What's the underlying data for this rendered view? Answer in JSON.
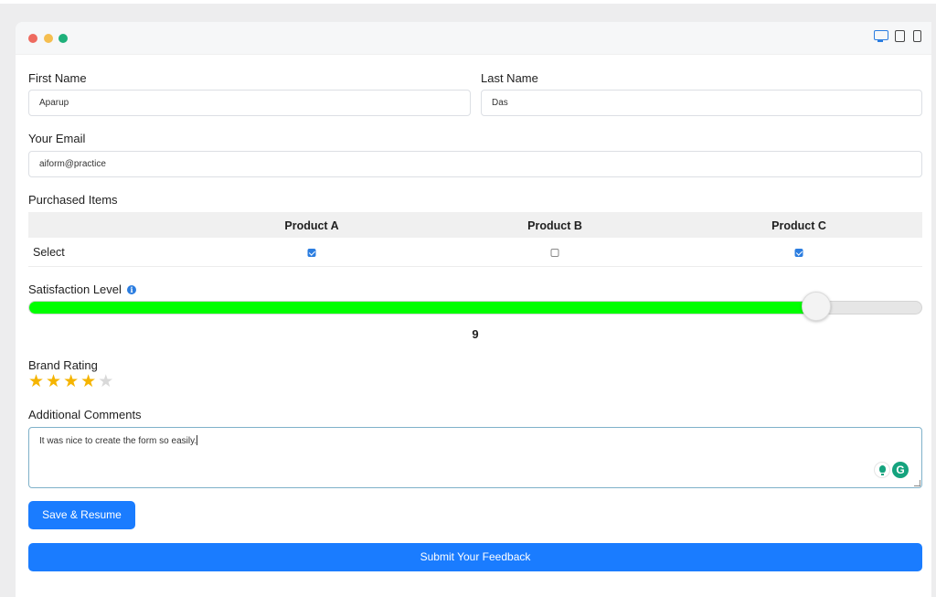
{
  "form": {
    "first_name": {
      "label": "First Name",
      "value": "Aparup"
    },
    "last_name": {
      "label": "Last Name",
      "value": "Das"
    },
    "email": {
      "label": "Your Email",
      "value": "aiform@practice"
    },
    "purchased": {
      "label": "Purchased Items",
      "columns": [
        "Product A",
        "Product B",
        "Product C"
      ],
      "row_label": "Select",
      "checked": [
        true,
        false,
        true
      ]
    },
    "satisfaction": {
      "label": "Satisfaction Level",
      "value": "9",
      "fraction": 0.88
    },
    "brand_rating": {
      "label": "Brand Rating",
      "rating": 4,
      "max": 5
    },
    "comments": {
      "label": "Additional Comments",
      "value": "It was nice to create the form so easily."
    },
    "save_label": "Save & Resume",
    "submit_label": "Submit Your Feedback"
  },
  "colors": {
    "accent": "#1a7cff",
    "slider_fill": "#00ff00",
    "star": "#f5b400"
  },
  "icons": [
    "desktop-icon",
    "tablet-icon",
    "mobile-icon",
    "info-icon",
    "grammarly-icon"
  ]
}
